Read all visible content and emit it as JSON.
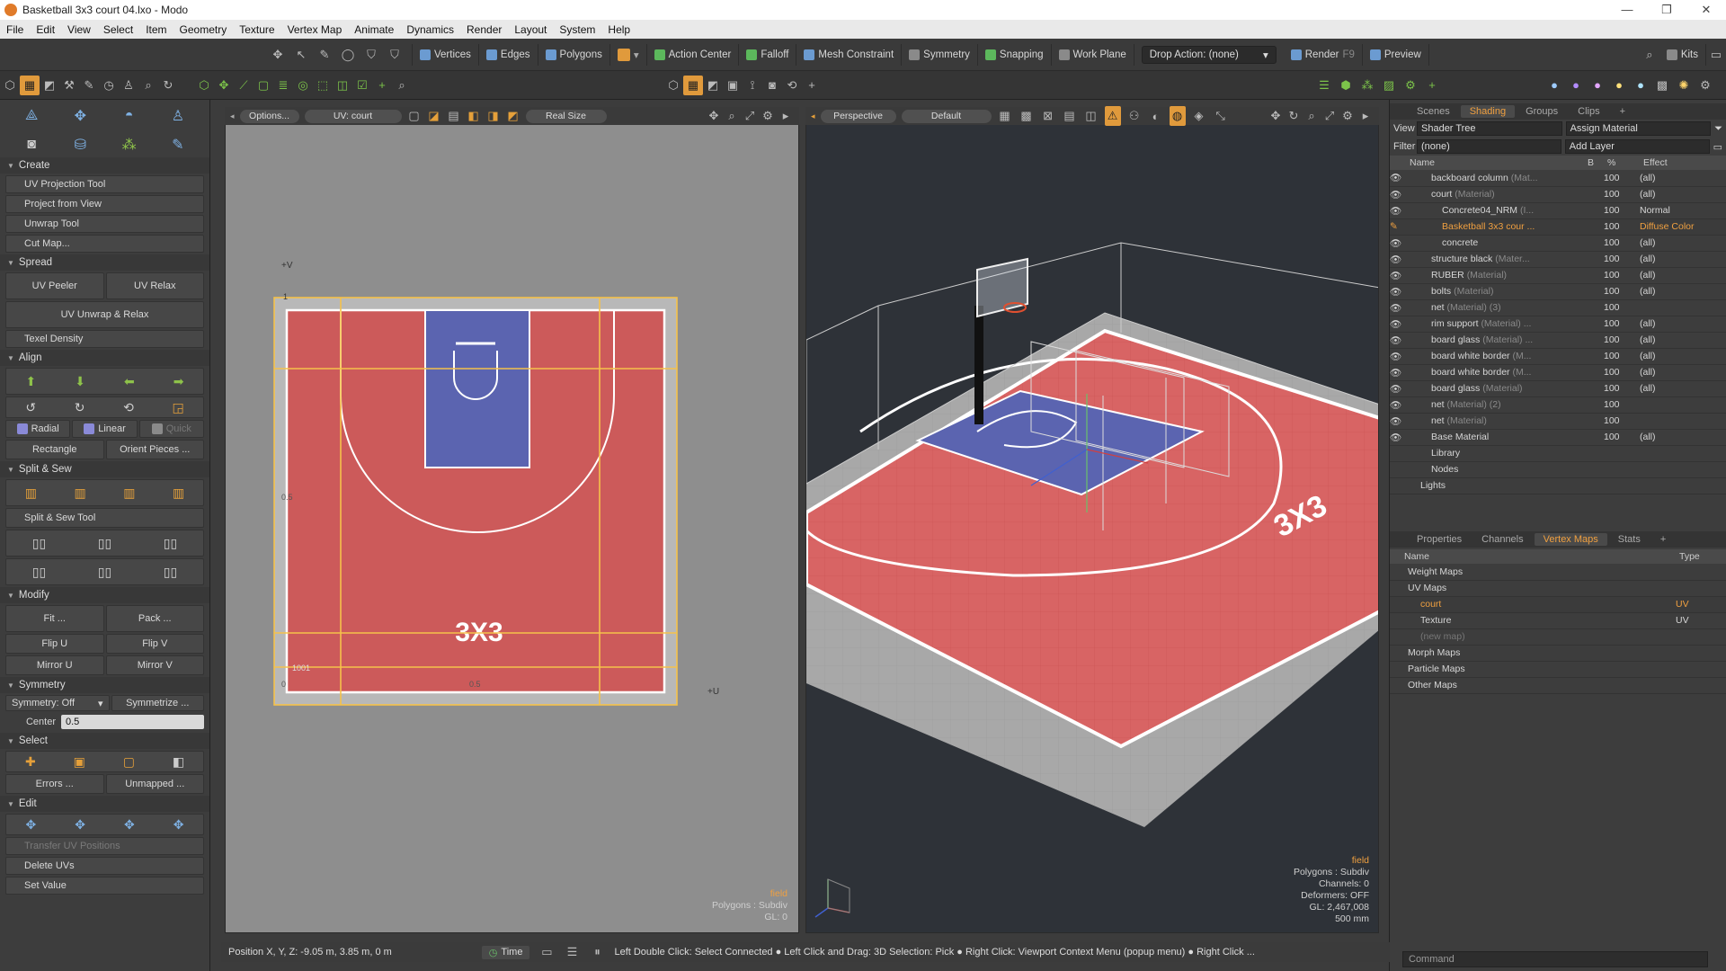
{
  "window": {
    "title": "Basketball 3x3 court 04.lxo - Modo"
  },
  "menu": [
    "File",
    "Edit",
    "View",
    "Select",
    "Item",
    "Geometry",
    "Texture",
    "Vertex Map",
    "Animate",
    "Dynamics",
    "Render",
    "Layout",
    "System",
    "Help"
  ],
  "toolbar": {
    "vertices": "Vertices",
    "edges": "Edges",
    "polygons": "Polygons",
    "action_center": "Action Center",
    "falloff": "Falloff",
    "mesh_constraint": "Mesh Constraint",
    "symmetry": "Symmetry",
    "snapping": "Snapping",
    "work_plane": "Work Plane",
    "drop_action": "Drop Action: (none)",
    "render": "Render",
    "render_key": "F9",
    "preview": "Preview",
    "kits": "Kits"
  },
  "left": {
    "create": "Create",
    "uv_projection": "UV Projection Tool",
    "project_view": "Project from View",
    "unwrap": "Unwrap Tool",
    "cut_map": "Cut Map...",
    "spread": "Spread",
    "uv_peeler": "UV Peeler",
    "uv_relax": "UV Relax",
    "uv_unwrap_relax": "UV Unwrap & Relax",
    "texel": "Texel Density",
    "align": "Align",
    "radial": "Radial",
    "linear": "Linear",
    "quick": "Quick",
    "rectangle": "Rectangle",
    "orient": "Orient Pieces ...",
    "split_sew": "Split & Sew",
    "split_sew_tool": "Split & Sew Tool",
    "modify": "Modify",
    "fit": "Fit ...",
    "pack": "Pack ...",
    "flip_u": "Flip U",
    "flip_v": "Flip V",
    "mirror_u": "Mirror U",
    "mirror_v": "Mirror V",
    "symmetry_sec": "Symmetry",
    "symmetry_off": "Symmetry: Off",
    "symmetrize": "Symmetrize ...",
    "center_label": "Center",
    "center_val": "0.5",
    "select": "Select",
    "errors": "Errors ...",
    "unmapped": "Unmapped ...",
    "edit": "Edit",
    "transfer": "Transfer UV Positions",
    "delete_uvs": "Delete UVs",
    "set_value": "Set Value"
  },
  "uv": {
    "options": "Options...",
    "uvmap": "UV: court",
    "realsize": "Real Size",
    "plus_v": "+V",
    "plus_u": "+U",
    "one": "1",
    "half_v": "0.5",
    "half_u": "0.5",
    "zero": "0",
    "tile": "1001",
    "field": "field",
    "polys": "Polygons : Subdiv",
    "gl": "GL: 0"
  },
  "vp": {
    "perspective": "Perspective",
    "default": "Default",
    "field": "field",
    "polys": "Polygons : Subdiv",
    "channels": "Channels: 0",
    "deformers": "Deformers: OFF",
    "gl": "GL: 2,467,008",
    "size": "500 mm"
  },
  "shading": {
    "tabs": [
      "Scenes",
      "Shading",
      "Groups",
      "Clips"
    ],
    "view_label": "View",
    "view_val": "Shader Tree",
    "assign": "Assign Material",
    "filter_label": "Filter",
    "filter_val": "(none)",
    "add_layer": "Add Layer",
    "headers": {
      "name": "Name",
      "b": "B",
      "pct": "%",
      "effect": "Effect"
    },
    "rows": [
      {
        "name": "backboard column",
        "type": "(Mat...",
        "pct": "100",
        "effect": "(all)"
      },
      {
        "name": "court",
        "type": "(Material)",
        "pct": "100",
        "effect": "(all)"
      },
      {
        "name": "Concrete04_NRM",
        "type": "(I...",
        "pct": "100",
        "effect": "Normal"
      },
      {
        "name": "Basketball 3x3 cour ...",
        "type": "",
        "pct": "100",
        "effect": "Diffuse Color"
      },
      {
        "name": "concrete",
        "type": "",
        "pct": "100",
        "effect": "(all)"
      },
      {
        "name": "structure black",
        "type": "(Mater...",
        "pct": "100",
        "effect": "(all)"
      },
      {
        "name": "RUBER",
        "type": "(Material)",
        "pct": "100",
        "effect": "(all)"
      },
      {
        "name": "bolts",
        "type": "(Material)",
        "pct": "100",
        "effect": "(all)"
      },
      {
        "name": "net",
        "type": "(Material) (3)",
        "pct": "100",
        "effect": ""
      },
      {
        "name": "rim support",
        "type": "(Material) ...",
        "pct": "100",
        "effect": "(all)"
      },
      {
        "name": "board glass",
        "type": "(Material) ...",
        "pct": "100",
        "effect": "(all)"
      },
      {
        "name": "board white border",
        "type": "(M...",
        "pct": "100",
        "effect": "(all)"
      },
      {
        "name": "board white border",
        "type": "(M...",
        "pct": "100",
        "effect": "(all)"
      },
      {
        "name": "board glass",
        "type": "(Material)",
        "pct": "100",
        "effect": "(all)"
      },
      {
        "name": "net",
        "type": "(Material) (2)",
        "pct": "100",
        "effect": ""
      },
      {
        "name": "net",
        "type": "(Material)",
        "pct": "100",
        "effect": ""
      },
      {
        "name": "Base Material",
        "type": "",
        "pct": "100",
        "effect": "(all)"
      },
      {
        "name": "Library",
        "type": "",
        "pct": "",
        "effect": ""
      },
      {
        "name": "Nodes",
        "type": "",
        "pct": "",
        "effect": ""
      },
      {
        "name": "Lights",
        "type": "",
        "pct": "",
        "effect": ""
      }
    ]
  },
  "vmaps": {
    "tabs": [
      "Properties",
      "Channels",
      "Vertex Maps",
      "Stats"
    ],
    "headers": {
      "name": "Name",
      "type": "Type"
    },
    "rows": [
      {
        "name": "Weight Maps",
        "type": ""
      },
      {
        "name": "UV Maps",
        "type": ""
      },
      {
        "name": "court",
        "type": "UV"
      },
      {
        "name": "Texture",
        "type": "UV"
      },
      {
        "name": "(new map)",
        "type": ""
      },
      {
        "name": "Morph Maps",
        "type": ""
      },
      {
        "name": "Particle Maps",
        "type": ""
      },
      {
        "name": "Other Maps",
        "type": ""
      }
    ]
  },
  "status": {
    "position": "Position X, Y, Z:  -9.05 m, 3.85 m, 0 m",
    "time": "Time",
    "hint": "Left Double Click: Select Connected ● Left Click and Drag: 3D Selection: Pick ● Right Click: Viewport Context Menu (popup menu) ● Right Click ..."
  },
  "command": {
    "placeholder": "Command"
  }
}
